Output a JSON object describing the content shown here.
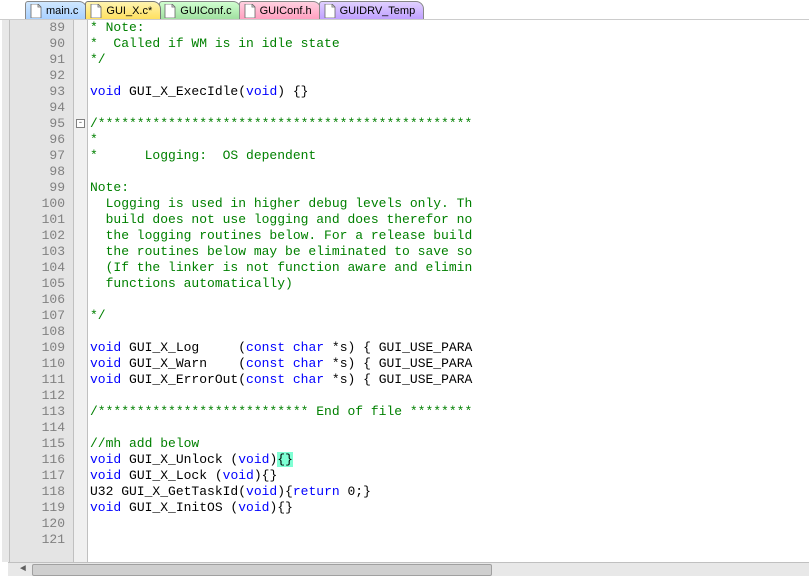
{
  "tabs": [
    {
      "label": "main.c",
      "color": "blue"
    },
    {
      "label": "GUI_X.c*",
      "color": "yellow"
    },
    {
      "label": "GUIConf.c",
      "color": "green"
    },
    {
      "label": "GUIConf.h",
      "color": "pink"
    },
    {
      "label": "GUIDRV_Temp",
      "color": "purple"
    }
  ],
  "first_line": 89,
  "last_line": 121,
  "fold_minus_line": 95,
  "lines": {
    "89": {
      "cm": "* Note:"
    },
    "90": {
      "cm": "*  Called if WM is in idle state"
    },
    "91": {
      "cm": "*/"
    },
    "92": {
      "plain": ""
    },
    "93": {
      "code": [
        [
          "kw",
          "void"
        ],
        [
          "plain",
          " GUI_X_ExecIdle("
        ],
        [
          "kw",
          "void"
        ],
        [
          "plain",
          ") {}"
        ]
      ]
    },
    "94": {
      "plain": ""
    },
    "95": {
      "cm": "/************************************************"
    },
    "96": {
      "cm": "*"
    },
    "97": {
      "cm": "*      Logging:  OS dependent"
    },
    "98": {
      "plain": ""
    },
    "99": {
      "cm": "Note:"
    },
    "100": {
      "cm": "  Logging is used in higher debug levels only. Th"
    },
    "101": {
      "cm": "  build does not use logging and does therefor no"
    },
    "102": {
      "cm": "  the logging routines below. For a release build"
    },
    "103": {
      "cm": "  the routines below may be eliminated to save so"
    },
    "104": {
      "cm": "  (If the linker is not function aware and elimin"
    },
    "105": {
      "cm": "  functions automatically)"
    },
    "106": {
      "plain": ""
    },
    "107": {
      "cm": "*/"
    },
    "108": {
      "plain": ""
    },
    "109": {
      "code": [
        [
          "kw",
          "void"
        ],
        [
          "plain",
          " GUI_X_Log     ("
        ],
        [
          "kw",
          "const"
        ],
        [
          "plain",
          " "
        ],
        [
          "kw",
          "char"
        ],
        [
          "plain",
          " *s) { GUI_USE_PARA"
        ]
      ]
    },
    "110": {
      "code": [
        [
          "kw",
          "void"
        ],
        [
          "plain",
          " GUI_X_Warn    ("
        ],
        [
          "kw",
          "const"
        ],
        [
          "plain",
          " "
        ],
        [
          "kw",
          "char"
        ],
        [
          "plain",
          " *s) { GUI_USE_PARA"
        ]
      ]
    },
    "111": {
      "code": [
        [
          "kw",
          "void"
        ],
        [
          "plain",
          " GUI_X_ErrorOut("
        ],
        [
          "kw",
          "const"
        ],
        [
          "plain",
          " "
        ],
        [
          "kw",
          "char"
        ],
        [
          "plain",
          " *s) { GUI_USE_PARA"
        ]
      ]
    },
    "112": {
      "plain": ""
    },
    "113": {
      "cm": "/*************************** End of file ********"
    },
    "114": {
      "plain": ""
    },
    "115": {
      "cm": "//mh add below"
    },
    "116": {
      "code": [
        [
          "kw",
          "void"
        ],
        [
          "plain",
          " GUI_X_Unlock ("
        ],
        [
          "kw",
          "void"
        ],
        [
          "plain",
          ")"
        ],
        [
          "hl",
          "{}"
        ]
      ]
    },
    "117": {
      "code": [
        [
          "kw",
          "void"
        ],
        [
          "plain",
          " GUI_X_Lock ("
        ],
        [
          "kw",
          "void"
        ],
        [
          "plain",
          "){}"
        ]
      ]
    },
    "118": {
      "code": [
        [
          "plain",
          "U32 GUI_X_GetTaskId("
        ],
        [
          "kw",
          "void"
        ],
        [
          "plain",
          "){"
        ],
        [
          "kw",
          "return"
        ],
        [
          "plain",
          " 0;}"
        ]
      ]
    },
    "119": {
      "code": [
        [
          "kw",
          "void"
        ],
        [
          "plain",
          " GUI_X_InitOS ("
        ],
        [
          "kw",
          "void"
        ],
        [
          "plain",
          "){}"
        ]
      ]
    },
    "120": {
      "plain": ""
    },
    "121": {
      "plain": ""
    }
  }
}
